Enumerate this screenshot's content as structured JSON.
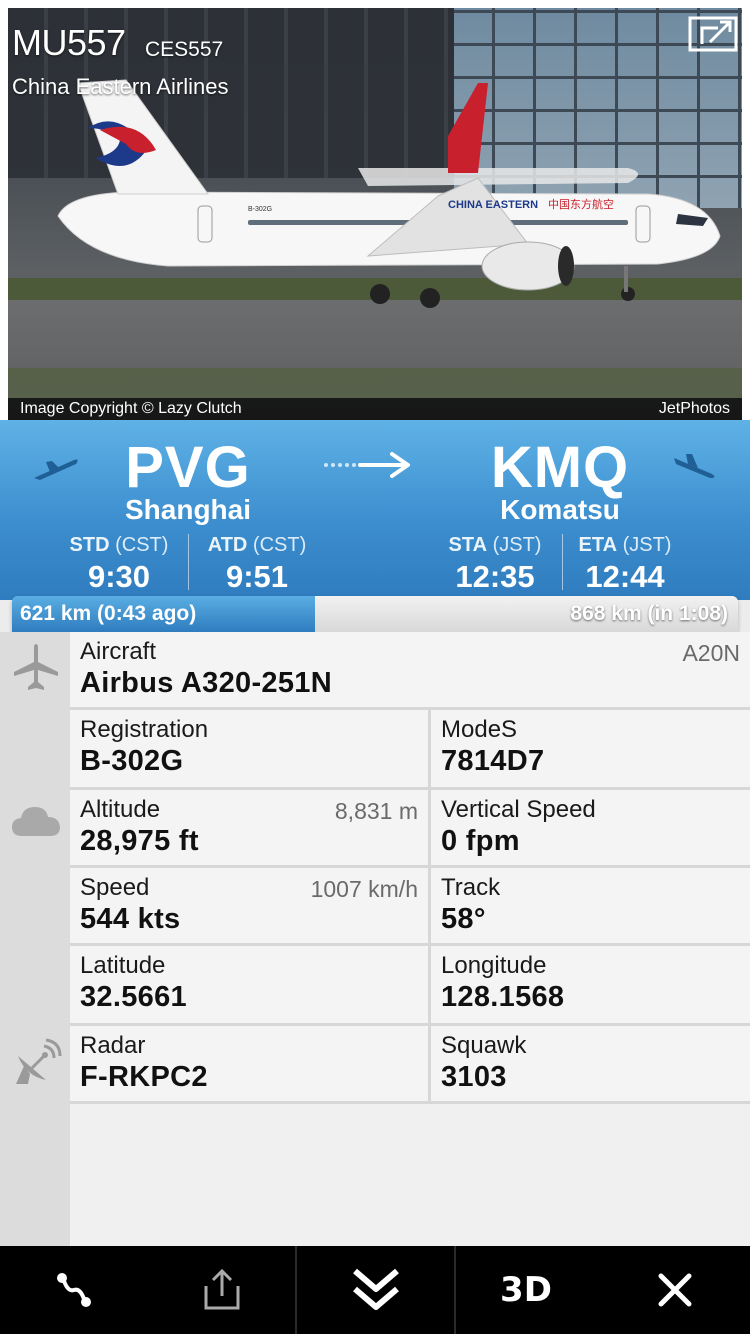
{
  "header": {
    "flight_number": "MU557",
    "callsign": "CES557",
    "airline": "China Eastern Airlines",
    "image_credit": "Image Copyright © Lazy Clutch",
    "image_source": "JetPhotos",
    "aircraft_livery_text": "CHINA EASTERN",
    "aircraft_livery_cn": "中国东方航空",
    "aircraft_reg_on_fuselage": "B-302G"
  },
  "route": {
    "origin": {
      "code": "PVG",
      "city": "Shanghai"
    },
    "destination": {
      "code": "KMQ",
      "city": "Komatsu"
    },
    "times": {
      "std": {
        "label": "STD",
        "tz": "(CST)",
        "value": "9:30"
      },
      "atd": {
        "label": "ATD",
        "tz": "(CST)",
        "value": "9:51"
      },
      "sta": {
        "label": "STA",
        "tz": "(JST)",
        "value": "12:35"
      },
      "eta": {
        "label": "ETA",
        "tz": "(JST)",
        "value": "12:44"
      }
    }
  },
  "progress": {
    "flown_text": "621 km (0:43 ago)",
    "remaining_text": "868 km (in 1:08)",
    "fraction": 0.417
  },
  "details": {
    "aircraft": {
      "label": "Aircraft",
      "value": "Airbus A320-251N",
      "code": "A20N"
    },
    "registration": {
      "label": "Registration",
      "value": "B-302G"
    },
    "modes": {
      "label": "ModeS",
      "value": "7814D7"
    },
    "altitude": {
      "label": "Altitude",
      "value": "28,975 ft",
      "aux": "8,831 m"
    },
    "vertical_speed": {
      "label": "Vertical Speed",
      "value": "0 fpm"
    },
    "speed": {
      "label": "Speed",
      "value": "544 kts",
      "aux": "1007 km/h"
    },
    "track": {
      "label": "Track",
      "value": "58°"
    },
    "latitude": {
      "label": "Latitude",
      "value": "32.5661"
    },
    "longitude": {
      "label": "Longitude",
      "value": "128.1568"
    },
    "radar": {
      "label": "Radar",
      "value": "F-RKPC2"
    },
    "squawk": {
      "label": "Squawk",
      "value": "3103"
    }
  },
  "toolbar": {
    "route_icon": "route-icon",
    "share_icon": "share-icon",
    "collapse_icon": "chevron-double-down-icon",
    "view_3d_label": "3D",
    "close_icon": "close-icon"
  },
  "colors": {
    "banner_top": "#5fb2e6",
    "banner_bottom": "#2f7cbf",
    "toolbar_bg": "#000000",
    "details_bg": "#f4f4f4"
  }
}
